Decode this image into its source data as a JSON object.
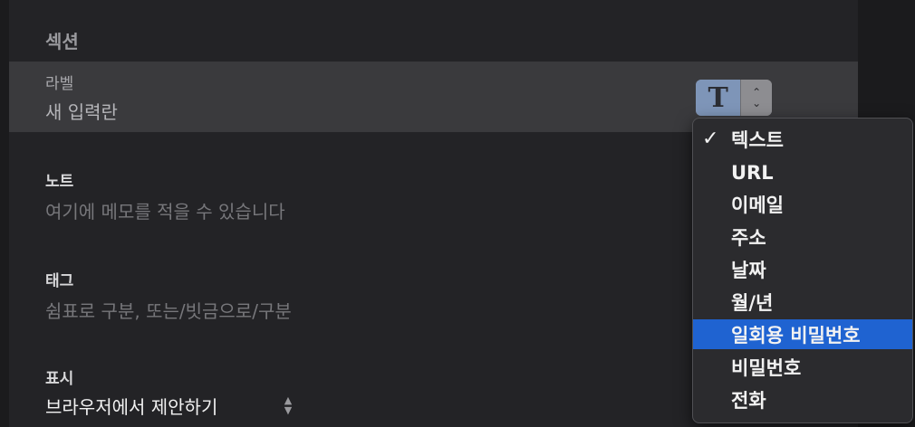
{
  "section": {
    "title": "섹션"
  },
  "fields": {
    "label": {
      "name": "라벨",
      "value": "새 입력란"
    },
    "note": {
      "name": "노트",
      "placeholder": "여기에 메모를 적을 수 있습니다"
    },
    "tags": {
      "name": "태그",
      "placeholder": "쉼표로 구분, 또는/빗금으로/구분"
    },
    "display": {
      "name": "표시",
      "value": "브라우저에서 제안하기"
    }
  },
  "type_button": {
    "glyph": "T",
    "icon": "text-type-icon"
  },
  "menu": {
    "check_glyph": "✓",
    "items": [
      "텍스트",
      "URL",
      "이메일",
      "주소",
      "날짜",
      "월/년",
      "일회용 비밀번호",
      "비밀번호",
      "전화"
    ],
    "checked_index": 0,
    "highlighted_index": 6
  },
  "colors": {
    "highlight": "#1f63d1",
    "type_button": "#7e95b8"
  }
}
